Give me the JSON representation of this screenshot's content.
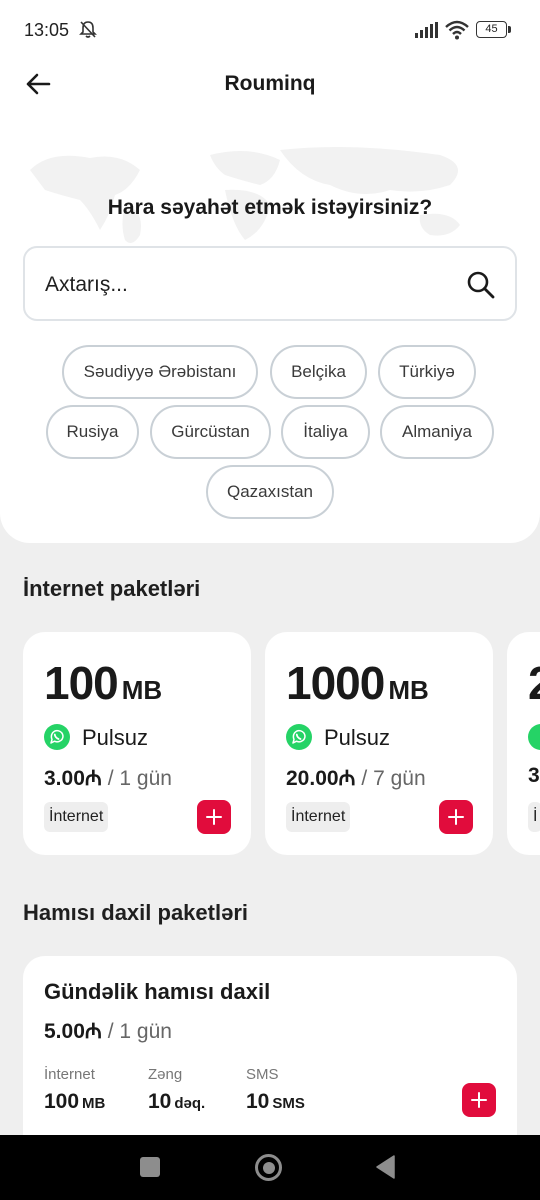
{
  "status_bar": {
    "time": "13:05",
    "battery": "45"
  },
  "header": {
    "title": "Rouminq"
  },
  "search_section": {
    "question": "Hara səyahət etmək istəyirsiniz?",
    "search_placeholder": "Axtarış..."
  },
  "countries": [
    "Səudiyyə Ərəbistanı",
    "Belçika",
    "Türkiyə",
    "Rusiya",
    "Gürcüstan",
    "İtaliya",
    "Almaniya",
    "Qazaxıstan"
  ],
  "internet_section": {
    "title": "İnternet paketləri",
    "packages": [
      {
        "amount": "100",
        "unit": "MB",
        "bonus": "Pulsuz",
        "price": "3.00₼",
        "period": "/ 1 gün",
        "tag": "İnternet"
      },
      {
        "amount": "1000",
        "unit": "MB",
        "bonus": "Pulsuz",
        "price": "20.00₼",
        "period": "/ 7 gün",
        "tag": "İnternet"
      },
      {
        "amount": "2",
        "unit": "",
        "bonus": "",
        "price": "3",
        "period": "",
        "tag": "İ"
      }
    ]
  },
  "all_inclusive_section": {
    "title": "Hamısı daxil paketləri",
    "package": {
      "name": "Gündəlik hamısı daxil",
      "price": "5.00₼",
      "period": "/ 1 gün",
      "internet_label": "İnternet",
      "internet_value": "100",
      "internet_unit": "MB",
      "call_label": "Zəng",
      "call_value": "10",
      "call_unit": "dəq.",
      "sms_label": "SMS",
      "sms_value": "10",
      "sms_unit": "SMS"
    }
  },
  "colors": {
    "accent": "#e10c3c",
    "whatsapp": "#25d366",
    "background": "#efefef"
  },
  "icons": [
    "back-arrow-icon",
    "search-icon",
    "whatsapp-icon",
    "plus-icon",
    "mute-icon",
    "signal-icon",
    "wifi-icon",
    "battery-icon"
  ]
}
